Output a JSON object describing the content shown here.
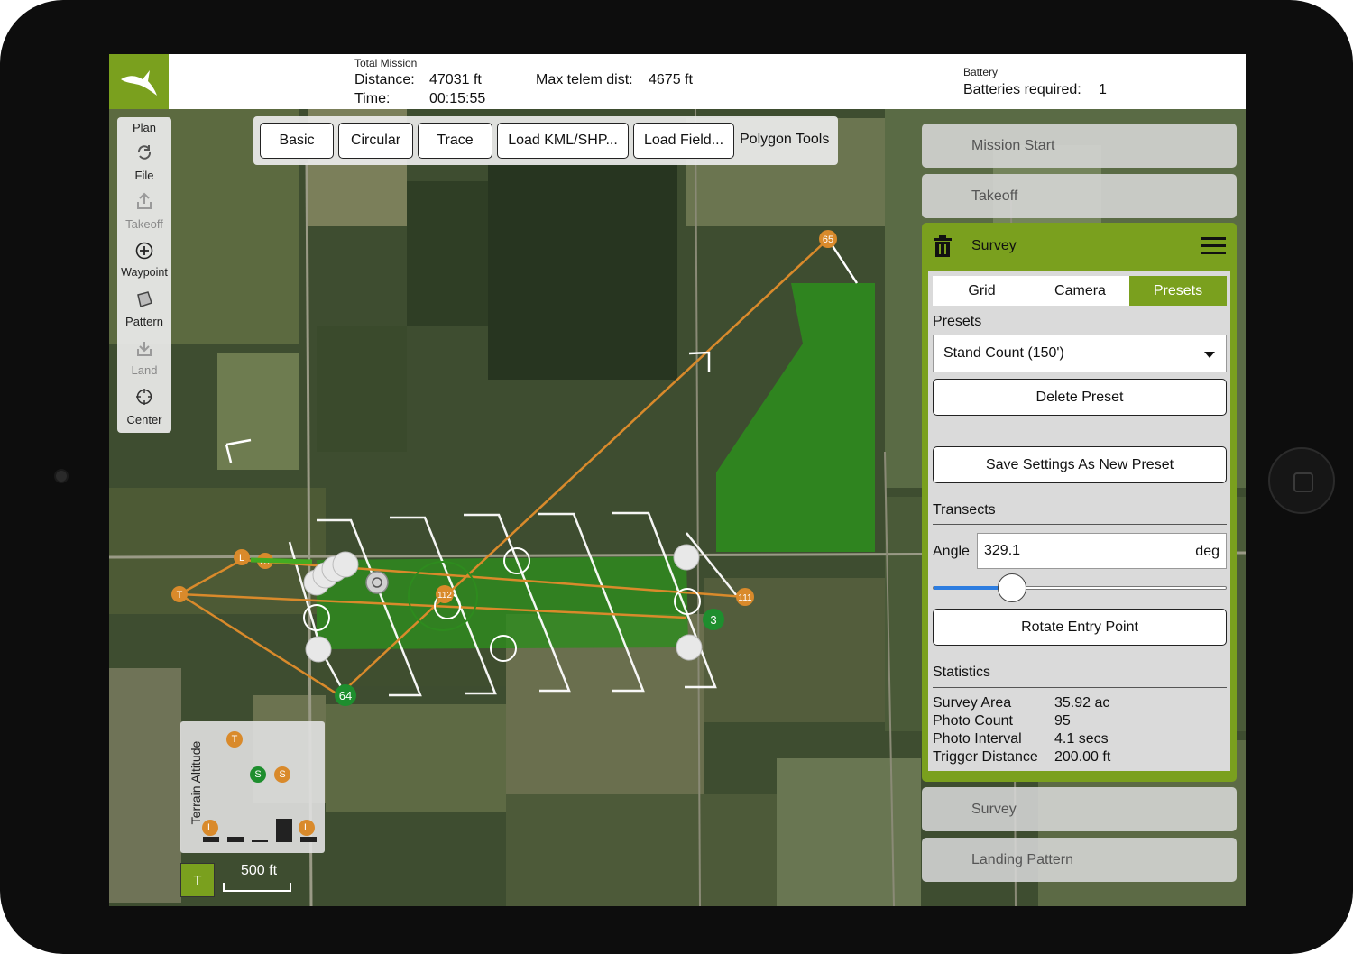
{
  "topbar": {
    "total_mission_label": "Total Mission",
    "distance_label": "Distance:",
    "distance_value": "47031 ft",
    "time_label": "Time:",
    "time_value": "00:15:55",
    "max_telem_label": "Max telem dist:",
    "max_telem_value": "4675 ft",
    "battery_label": "Battery",
    "batteries_required_label": "Batteries required:",
    "batteries_required_value": "1"
  },
  "left_toolbar": {
    "items": [
      {
        "label": "Plan",
        "icon": "plan-label"
      },
      {
        "label": "File",
        "icon": "sync-icon"
      },
      {
        "label": "Takeoff",
        "icon": "takeoff-icon"
      },
      {
        "label": "Waypoint",
        "icon": "plus-circle-icon"
      },
      {
        "label": "Pattern",
        "icon": "pattern-icon"
      },
      {
        "label": "Land",
        "icon": "land-icon"
      },
      {
        "label": "Center",
        "icon": "crosshair-icon"
      }
    ]
  },
  "pattern_toolbar": {
    "basic": "Basic",
    "circular": "Circular",
    "trace": "Trace",
    "load_kml": "Load KML/SHP...",
    "load_field": "Load Field...",
    "polygon_tools": "Polygon Tools"
  },
  "right_panel": {
    "mission_start": "Mission Start",
    "takeoff": "Takeoff",
    "survey_title": "Survey",
    "tabs": [
      "Grid",
      "Camera",
      "Presets"
    ],
    "active_tab": "Presets",
    "presets_label": "Presets",
    "preset_selected": "Stand Count (150')",
    "delete_preset": "Delete Preset",
    "save_preset": "Save Settings As New Preset",
    "transects_label": "Transects",
    "angle_label": "Angle",
    "angle_value": "329.1",
    "angle_unit": "deg",
    "angle_slider_fraction": 0.27,
    "rotate_entry": "Rotate Entry Point",
    "statistics_label": "Statistics",
    "stats": [
      {
        "key": "Survey Area",
        "value": "35.92 ac"
      },
      {
        "key": "Photo Count",
        "value": "95"
      },
      {
        "key": "Photo Interval",
        "value": "4.1 secs"
      },
      {
        "key": "Trigger Distance",
        "value": "200.00 ft"
      }
    ],
    "survey_collapsed": "Survey",
    "landing_pattern": "Landing Pattern"
  },
  "map": {
    "markers": {
      "waypoint_65": "65",
      "waypoint_64": "64",
      "waypoint_3": "3",
      "waypoint_111": "111",
      "waypoint_112": "112",
      "waypoint_112b": "112",
      "takeoff": "T",
      "land": "L"
    },
    "colors": {
      "accent": "#7aa01e",
      "path": "#d98a2b",
      "survey_fill": "#2e8b1e"
    }
  },
  "terrain_widget": {
    "label": "Terrain Altitude",
    "markers": {
      "t": "T",
      "s1": "S",
      "s2": "S",
      "l1": "L",
      "l2": "L"
    }
  },
  "bottom": {
    "t_button": "T",
    "scale": "500 ft"
  }
}
